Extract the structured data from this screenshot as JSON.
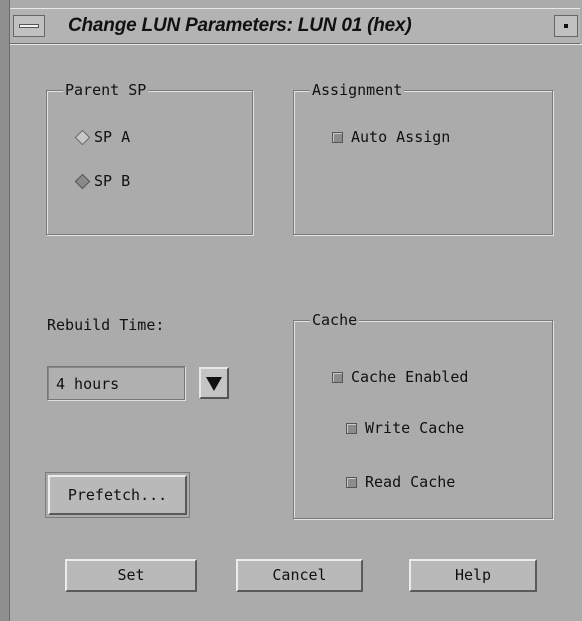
{
  "window": {
    "title": "Change LUN Parameters: LUN 01 (hex)"
  },
  "parent_sp": {
    "legend": "Parent SP",
    "options": [
      {
        "label": "SP A",
        "selected": false
      },
      {
        "label": "SP B",
        "selected": true
      }
    ]
  },
  "assignment": {
    "legend": "Assignment",
    "auto_assign_label": "Auto Assign",
    "auto_assign_checked": false
  },
  "rebuild": {
    "label": "Rebuild Time:",
    "value": "4 hours"
  },
  "cache": {
    "legend": "Cache",
    "items": [
      {
        "label": "Cache Enabled",
        "checked": false
      },
      {
        "label": "Write Cache",
        "checked": false
      },
      {
        "label": "Read Cache",
        "checked": false
      }
    ]
  },
  "buttons": {
    "prefetch": "Prefetch...",
    "set": "Set",
    "cancel": "Cancel",
    "help": "Help"
  },
  "icons": {
    "window_menu": "window-menu-icon",
    "minimize": "minimize-icon",
    "dropdown": "dropdown-arrow-icon"
  }
}
